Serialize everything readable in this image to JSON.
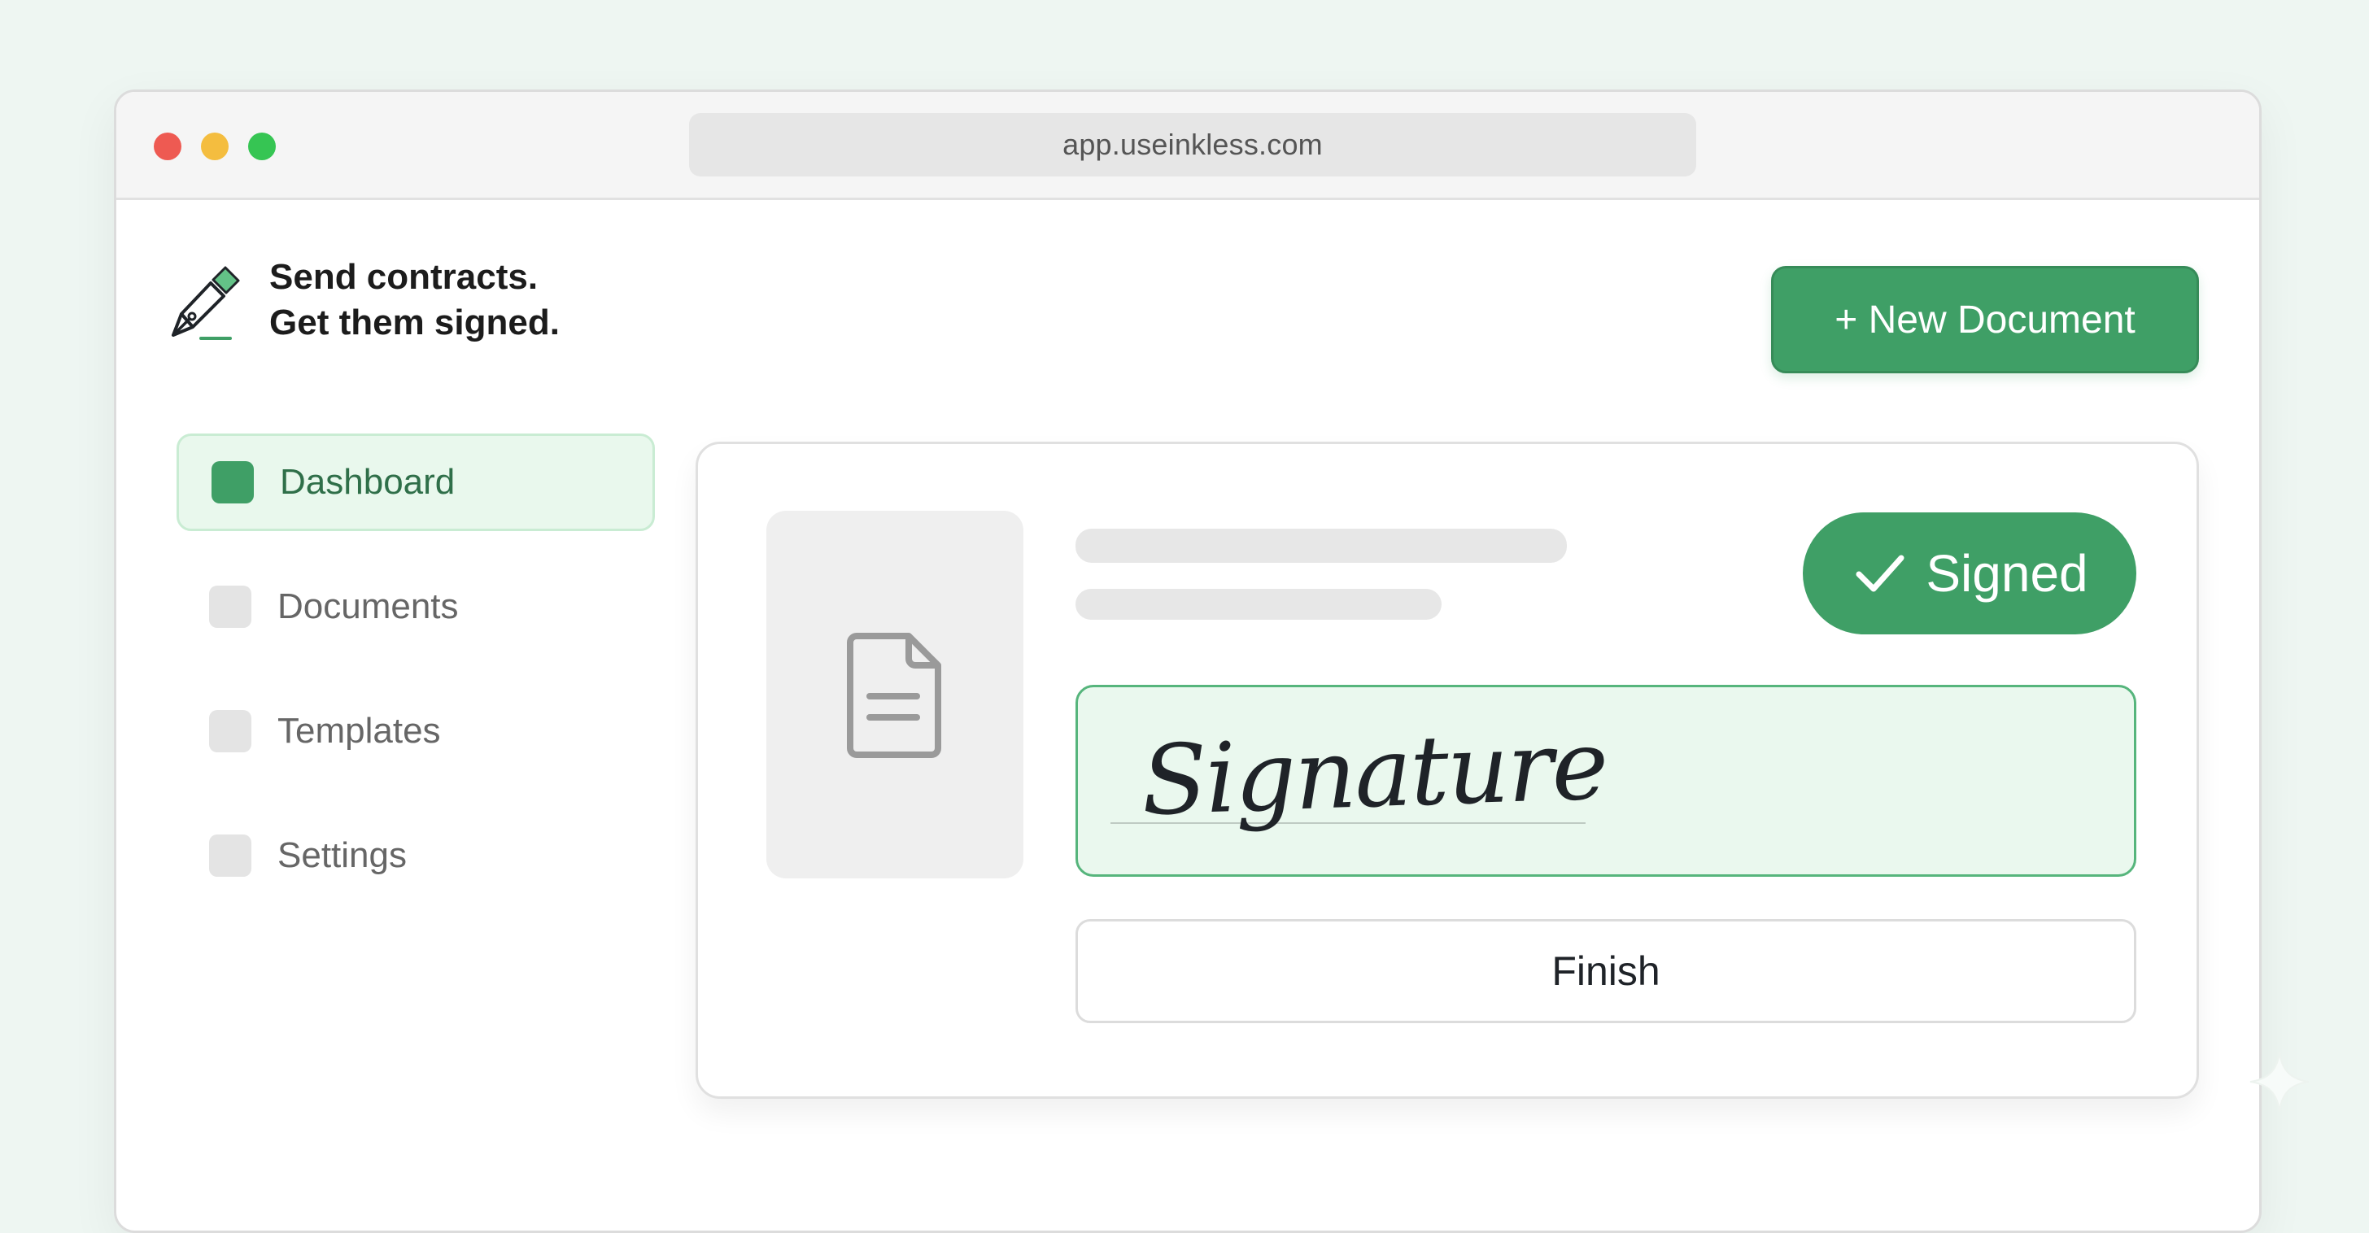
{
  "browser": {
    "url": "app.useinkless.com"
  },
  "brand": {
    "line1": "Send contracts.",
    "line2": "Get them signed.",
    "icon": "pen-nib-icon"
  },
  "header": {
    "new_document_label": "+ New Document"
  },
  "sidebar": {
    "items": [
      {
        "label": "Dashboard",
        "active": true
      },
      {
        "label": "Documents",
        "active": false
      },
      {
        "label": "Templates",
        "active": false
      },
      {
        "label": "Settings",
        "active": false
      }
    ]
  },
  "main": {
    "status_label": "Signed",
    "signature_text": "Signature",
    "finish_label": "Finish",
    "document_icon": "document-icon"
  },
  "colors": {
    "accent": "#3f9f66",
    "active_bg": "#e9f8ed",
    "signature_bg": "#eaf8ee"
  }
}
